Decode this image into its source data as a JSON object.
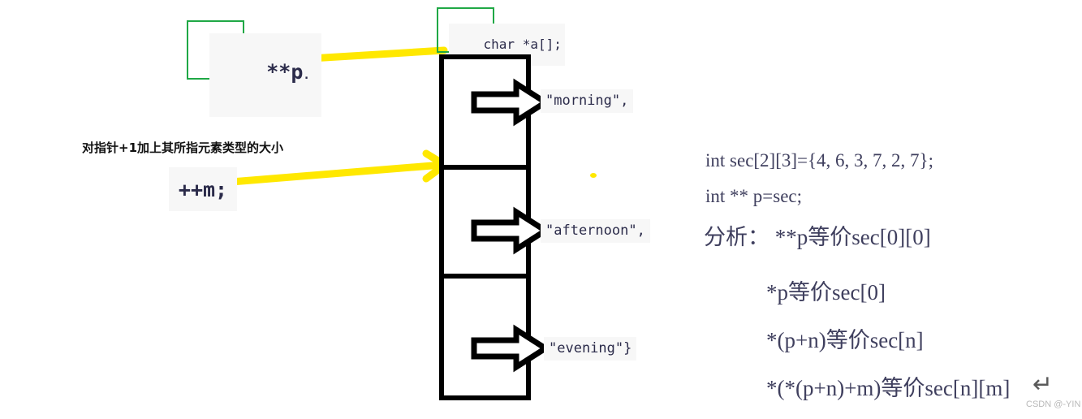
{
  "diagram": {
    "title_note": "C pointer-to-array-of-strings diagram",
    "colors": {
      "highlight_yellow": "#ffe800",
      "annotation_green": "#1fa845",
      "box_black": "#000000",
      "code_text": "#2b2b4a",
      "serif_text": "#3f3f5e",
      "chip_bg": "#f7f7f7"
    }
  },
  "left": {
    "pointer_label": "**p",
    "pointer_label_trailing": ".",
    "caption": "对指针+1加上其所指元素类型的大小",
    "increment_expr": "++m;"
  },
  "center": {
    "declaration": "char *a[]",
    "declaration_trailing": ";",
    "cells": [
      {
        "value": "\"morning\","
      },
      {
        "value": "\"afternoon\","
      },
      {
        "value": "\"evening\"}"
      }
    ]
  },
  "right": {
    "lines": [
      {
        "text": "int sec[2][3]={4, 6, 3, 7, 2, 7};",
        "size": "small"
      },
      {
        "text": "int ** p=sec;",
        "size": "small"
      },
      {
        "text": "分析： **p等价sec[0][0]",
        "size": "big"
      },
      {
        "text": "*p等价sec[0]",
        "size": "big"
      },
      {
        "text": "*(p+n)等价sec[n]",
        "size": "big"
      },
      {
        "text": "*(*(p+n)+m)等价sec[n][m]",
        "size": "big"
      }
    ]
  },
  "watermark": {
    "text": "CSDN @-YIN",
    "cursor_glyph": "↵"
  }
}
